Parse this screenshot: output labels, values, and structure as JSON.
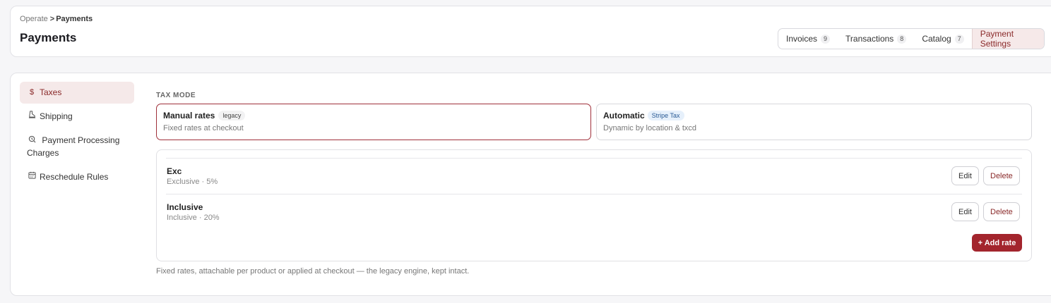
{
  "breadcrumb": {
    "parent": "Operate",
    "separator": ">",
    "current": "Payments"
  },
  "page_title": "Payments",
  "tabs": [
    {
      "label": "Invoices",
      "count": "9"
    },
    {
      "label": "Transactions",
      "count": "8"
    },
    {
      "label": "Catalog",
      "count": "7"
    },
    {
      "label": "Payment Settings",
      "active": true
    }
  ],
  "sidebar": {
    "items": [
      {
        "label": "Taxes",
        "icon": "dollar-icon",
        "active": true
      },
      {
        "label": "Shipping",
        "icon": "shipping-icon"
      },
      {
        "label": "Payment Processing Charges",
        "icon": "processing-icon"
      },
      {
        "label": "Reschedule Rules",
        "icon": "calendar-icon"
      }
    ]
  },
  "tax_mode": {
    "section_label": "TAX MODE",
    "manual": {
      "title": "Manual rates",
      "badge": "legacy",
      "subtitle": "Fixed rates at checkout",
      "selected": true
    },
    "automatic": {
      "title": "Automatic",
      "badge": "Stripe Tax",
      "subtitle": "Dynamic by location & txcd"
    }
  },
  "rates": [
    {
      "name": "Exc",
      "desc": "Exclusive · 5%"
    },
    {
      "name": "Inclusive",
      "desc": "Inclusive · 20%"
    }
  ],
  "buttons": {
    "edit": "Edit",
    "delete": "Delete",
    "add_rate": "+ Add rate"
  },
  "footnote": "Fixed rates, attachable per product or applied at checkout — the legacy engine, kept intact.",
  "colors": {
    "accent": "#a3252d",
    "active_bg": "#f5e9e9"
  }
}
